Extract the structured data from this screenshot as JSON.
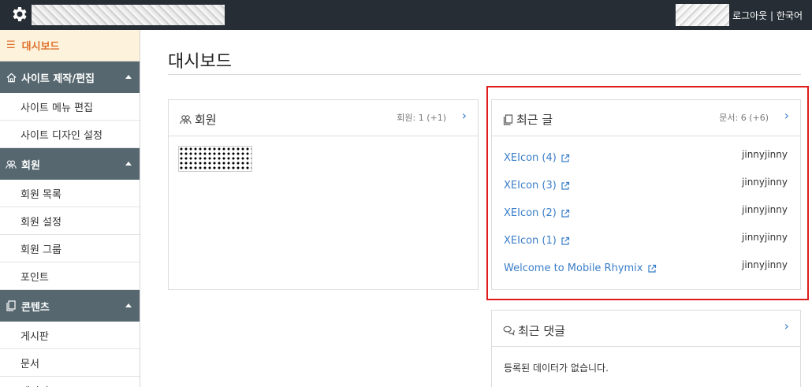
{
  "topbar": {
    "logout_label": "로그아웃",
    "separator": " | ",
    "language_label": "한국어"
  },
  "sidebar": {
    "dashboard_label": "대시보드",
    "groups": [
      {
        "label": "사이트 제작/편집",
        "icon": "home-icon",
        "items": [
          "사이트 메뉴 편집",
          "사이트 디자인 설정"
        ]
      },
      {
        "label": "회원",
        "icon": "users-icon",
        "items": [
          "회원 목록",
          "회원 설정",
          "회원 그룹",
          "포인트"
        ]
      },
      {
        "label": "콘텐츠",
        "icon": "documents-icon",
        "items": [
          "게시판",
          "문서",
          "페이지"
        ]
      }
    ]
  },
  "main": {
    "page_title": "대시보드",
    "member_panel": {
      "title": "회원",
      "count": "회원: 1 (+1)",
      "more": "›"
    },
    "recent_posts": {
      "title": "최근 글",
      "count": "문서: 6 (+6)",
      "more": "›",
      "posts": [
        {
          "title": "XEIcon (4)",
          "author": "jinnyjinny"
        },
        {
          "title": "XEIcon (3)",
          "author": "jinnyjinny"
        },
        {
          "title": "XEIcon (2)",
          "author": "jinnyjinny"
        },
        {
          "title": "XEIcon (1)",
          "author": "jinnyjinny"
        },
        {
          "title": "Welcome to Mobile Rhymix",
          "author": "jinnyjinny"
        }
      ]
    },
    "recent_comments": {
      "title": "최근 댓글",
      "more": "›",
      "empty_message": "등록된 데이터가 없습니다."
    }
  },
  "colors": {
    "topbar": "#262d34",
    "sidebar_group": "#56676f",
    "dashboard_bg": "#fdf3dd",
    "dashboard_text": "#e0702a",
    "link": "#3a7ec9",
    "highlight": "#e01b1b"
  }
}
